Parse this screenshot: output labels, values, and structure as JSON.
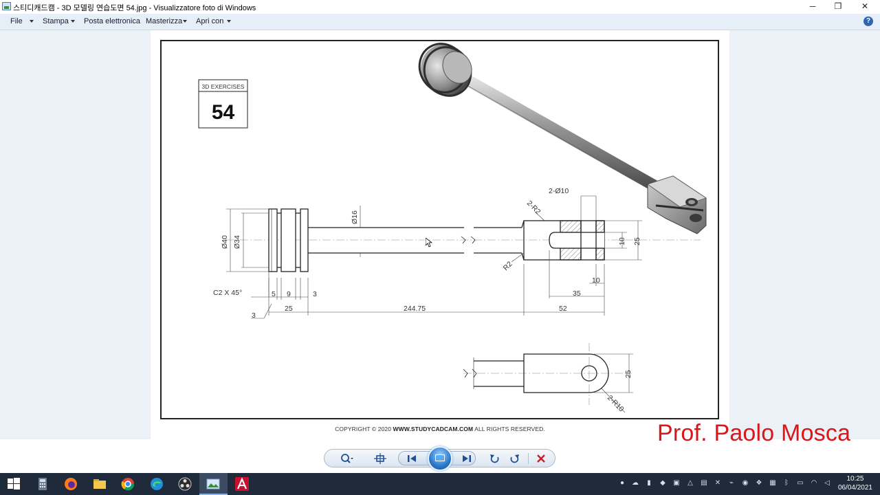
{
  "window": {
    "title": "스티디캐드캠 - 3D 모델링 연습도면 54.jpg - Visualizzatore foto di Windows",
    "minimize_glyph": "─",
    "restore_glyph": "❐",
    "close_glyph": "✕"
  },
  "menu": {
    "items": [
      {
        "label": "File",
        "has_caret": true
      },
      {
        "label": "Stampa",
        "has_caret": true
      },
      {
        "label": "Posta elettronica",
        "has_caret": false
      },
      {
        "label": "Masterizza",
        "has_caret": true
      },
      {
        "label": "Apri con",
        "has_caret": true
      }
    ],
    "help_glyph": "?"
  },
  "drawing": {
    "badge_label": "3D EXERCISES",
    "badge_number": "54",
    "dims": {
      "d40": "Ø40",
      "d34": "Ø34",
      "d16": "Ø16",
      "two_d10": "2-Ø10",
      "two_r2": "2-R2",
      "r2": "R2",
      "v10": "10",
      "v25_side": "25",
      "h10": "10",
      "h35": "35",
      "h52": "52",
      "chamfer": "C2 X 45°",
      "h5": "5",
      "h9": "9",
      "h3a": "3",
      "h3b": "3",
      "h25": "25",
      "h244": "244.75",
      "v25_bottom": "25",
      "two_r10": "2-R10"
    },
    "copyright_prefix": "COPYRIGHT © 2020",
    "copyright_site": "WWW.STUDYCADCAM.COM",
    "copyright_suffix": "ALL RIGHTS RESERVED."
  },
  "overlay": {
    "author": "Prof. Paolo Mosca"
  },
  "controls": {
    "zoom_icon": "zoom-icon",
    "actual_size_icon": "fit-icon",
    "prev_icon": "previous-icon",
    "slideshow_icon": "slideshow-icon",
    "next_icon": "next-icon",
    "rotate_ccw_icon": "rotate-left-icon",
    "rotate_cw_icon": "rotate-right-icon",
    "delete_icon": "delete-icon"
  },
  "taskbar": {
    "time": "10:25",
    "date": "06/04/2021",
    "colors": {
      "bar": "#1f2a3a",
      "accent": "#8bb6e8"
    }
  }
}
